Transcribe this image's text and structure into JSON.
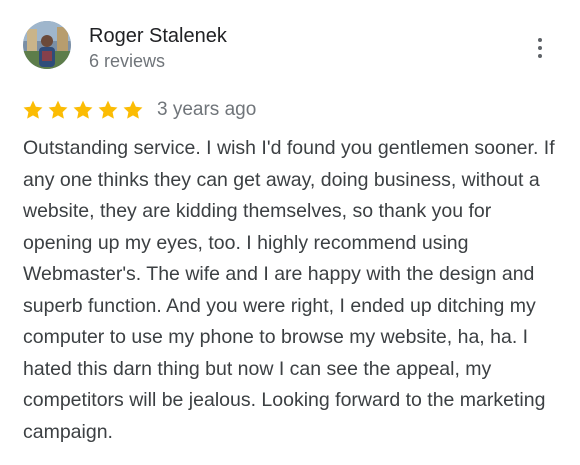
{
  "reviewer": {
    "name": "Roger Stalenek",
    "review_count": "6 reviews",
    "avatar_icon": "profile-photo"
  },
  "review": {
    "rating": 5,
    "rating_max": 5,
    "star_color": "#fbbc04",
    "date": "3 years ago",
    "text": "Outstanding service. I wish I'd found you gentlemen sooner. If any one thinks they can get away, doing business, without a website, they are kidding themselves, so thank you for opening up my eyes, too. I highly recommend using Webmaster's. The wife and I are happy with the design and superb function. And you were right, I ended up ditching my computer to use my phone to browse my website, ha, ha. I hated this darn thing but now I can see the appeal, my competitors will be jealous. Looking forward to the marketing campaign."
  },
  "actions": {
    "more_icon": "more-vert-icon"
  }
}
